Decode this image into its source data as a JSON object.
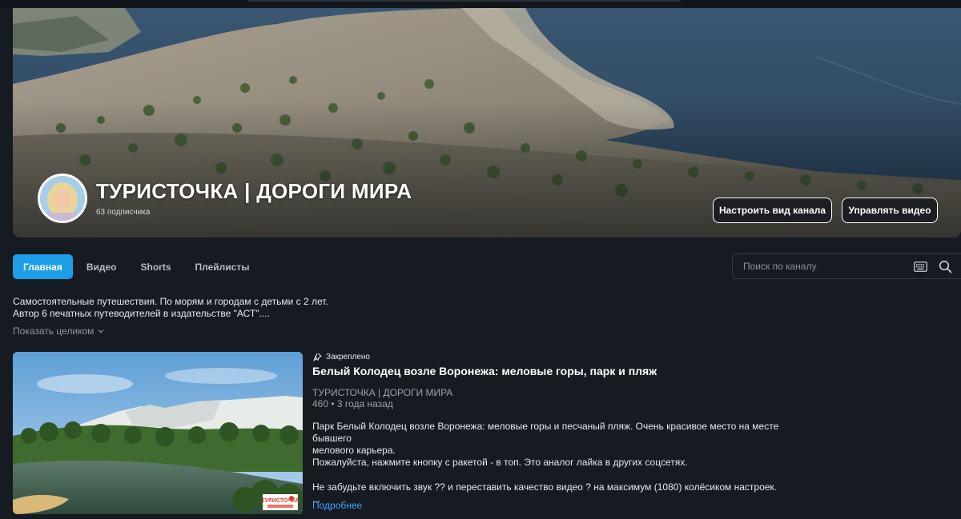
{
  "channel": {
    "title": "ТУРИСТОЧКА | ДОРОГИ МИРА",
    "subscribers": "63 подписчика",
    "buttons": {
      "customize": "Настроить вид канала",
      "manage": "Управлять видео"
    }
  },
  "tabs": [
    {
      "label": "Главная",
      "active": true
    },
    {
      "label": "Видео",
      "active": false
    },
    {
      "label": "Shorts",
      "active": false
    },
    {
      "label": "Плейлисты",
      "active": false
    }
  ],
  "search": {
    "placeholder": "Поиск по каналу",
    "keyboard_icon": "keyboard-icon",
    "search_icon": "search-icon"
  },
  "about": {
    "line1": "Самостоятельные путешествия. По морям и городам с детьми с 2 лет.",
    "line2": "Автор 6 печатных путеводителей в издательстве \"АСТ\"....",
    "show_more": "Показать целиком"
  },
  "pinned_video": {
    "pinned_label": "Закреплено",
    "title": "Белый Колодец возле Воронежа: меловые горы, парк и пляж",
    "channel": "ТУРИСТОЧКА | ДОРОГИ МИРА",
    "views": "460",
    "separator": "•",
    "age": "3 года назад",
    "description": [
      "Парк Белый Колодец возле Воронежа: меловые горы и песчаный пляж. Очень красивое место на месте бывшего",
      "мелового карьера.",
      "Пожалуйста, нажмите кнопку с ракетой - в топ. Это аналог лайка в других соцсетях.",
      "",
      "Не забудьте включить звук ?? и переставить качество видео ? на максимум (1080) колёсиком настроек.",
      "..."
    ],
    "read_more": "Подробнее",
    "thumb_watermark": "ТУРИСТОЧКА"
  },
  "colors": {
    "accent": "#1e9ee8",
    "link": "#3ea6ff",
    "background": "#161b22"
  }
}
